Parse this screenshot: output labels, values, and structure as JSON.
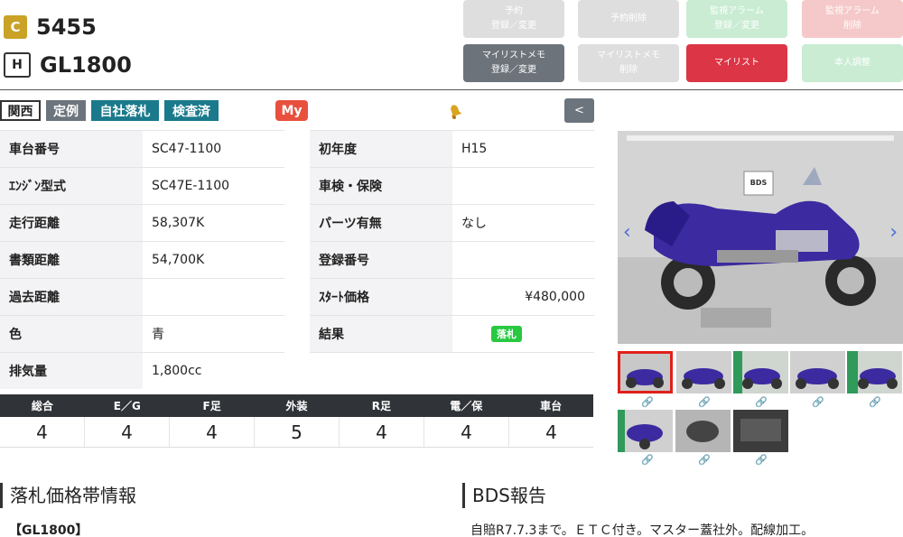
{
  "header": {
    "c_badge": "C",
    "lot_number": "5455",
    "h_badge": "H",
    "model": "GL1800"
  },
  "buttons": [
    {
      "label": "予約\n登録／変更",
      "color": "#dedede"
    },
    {
      "label": "予約削除",
      "color": "#dedede"
    },
    {
      "label": "監視アラーム\n登録／変更",
      "color": "#c9ecd3"
    },
    {
      "label": "監視アラーム\n削除",
      "color": "#f5c9c9"
    },
    {
      "label": "マイリストメモ\n登録／変更",
      "color": "#6c737a"
    },
    {
      "label": "マイリストメモ\n削除",
      "color": "#dedede"
    },
    {
      "label": "マイリスト",
      "color": "#dc3545"
    },
    {
      "label": "本人調整",
      "color": "#c9ecd3"
    }
  ],
  "tags": [
    "関西",
    "定例",
    "自社落札",
    "検査済"
  ],
  "my_label": "My",
  "back_label": "<",
  "specs_left": [
    {
      "label": "車台番号",
      "value": "SC47-1100"
    },
    {
      "label": "ｴﾝｼﾞﾝ型式",
      "value": "SC47E-1100"
    },
    {
      "label": "走行距離",
      "value": "58,307K"
    },
    {
      "label": "書類距離",
      "value": "54,700K"
    },
    {
      "label": "過去距離",
      "value": ""
    },
    {
      "label": "色",
      "value": "青"
    },
    {
      "label": "排気量",
      "value": "1,800cc"
    }
  ],
  "specs_right": [
    {
      "label": "初年度",
      "value": "H15"
    },
    {
      "label": "車検・保険",
      "value": ""
    },
    {
      "label": "パーツ有無",
      "value": "なし"
    },
    {
      "label": "登録番号",
      "value": ""
    },
    {
      "label": "ｽﾀｰﾄ価格",
      "value": "¥480,000"
    },
    {
      "label": "結果",
      "value": "落札"
    }
  ],
  "grades": {
    "headers": [
      "総合",
      "E／G",
      "F足",
      "外装",
      "R足",
      "電／保",
      "車台"
    ],
    "values": [
      "4",
      "4",
      "4",
      "5",
      "4",
      "4",
      "4"
    ]
  },
  "sections": {
    "price_title": "落札価格帯情報",
    "model_tag": "【GL1800】",
    "report_title": "BDS報告",
    "report_text": "自賠R7.7.3まで。ＥＴＣ付き。マスター蓋社外。配線加工。"
  },
  "image": {
    "sign_text": "BDS"
  },
  "colors": {
    "teal": "#1a7a8c",
    "gray_tag": "#6c757d",
    "red": "#dc3545",
    "green": "#28c840",
    "gold": "#c9a227"
  }
}
